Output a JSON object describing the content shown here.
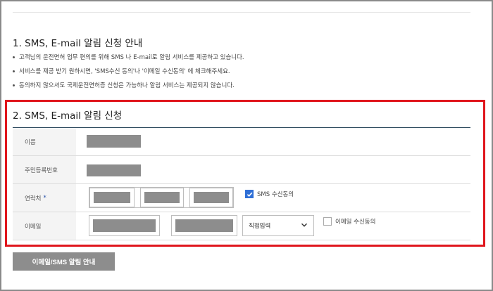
{
  "section1": {
    "title": "1. SMS, E-mail 알림 신청 안내",
    "notices": [
      "고객님의 운전면허 업무 편의를 위해 SMS 나 E-mail로 알림 서비스를 제공하고 있습니다.",
      "서비스를 제공 받기 원하시면, 'SMS수신 동의'나 '이메일 수신동의' 에 체크해주세요.",
      "동의하지 않으셔도 국제운전면허증 신청은 가능하나 알림 서비스는 제공되지 않습니다."
    ]
  },
  "section2": {
    "title": "2. SMS, E-mail 알림 신청",
    "rows": {
      "name": {
        "label": "이름"
      },
      "rrn": {
        "label": "주민등록번호"
      },
      "phone": {
        "label": "연락처",
        "required_mark": "*",
        "consent_label": "SMS 수신동의",
        "consent_checked": true
      },
      "email": {
        "label": "이메일",
        "domain_select": "직접입력",
        "consent_label": "이메일 수신동의",
        "consent_checked": false
      }
    }
  },
  "button": {
    "label": "이메일/SMS 알림 안내"
  },
  "colors": {
    "highlight": "#e0161d",
    "checkbox": "#2f6fd6",
    "mask": "#8d8d8d"
  }
}
